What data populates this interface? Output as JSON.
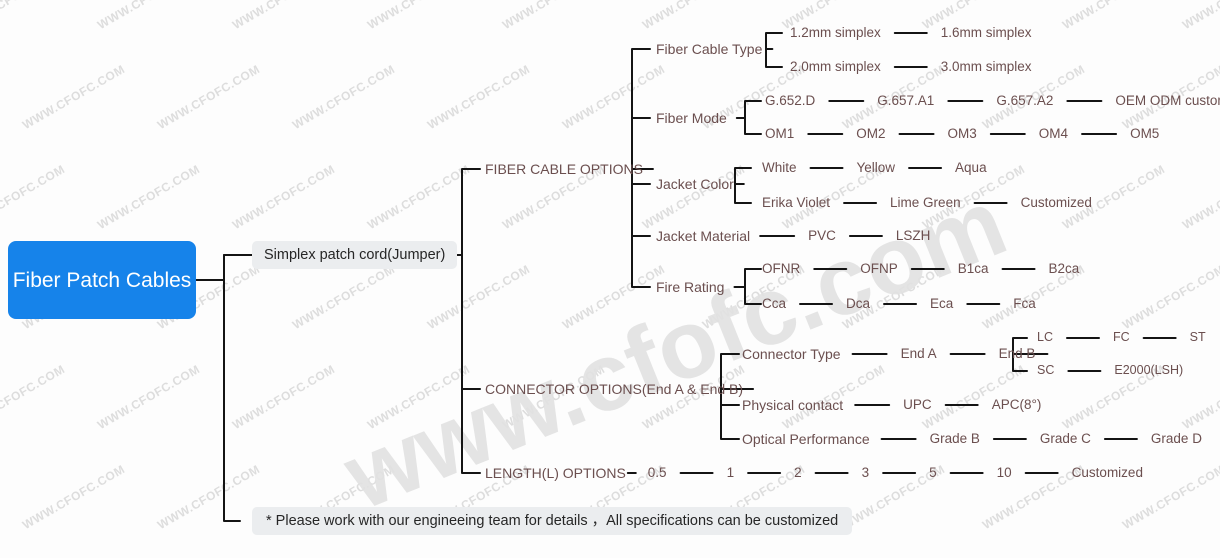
{
  "theme": {
    "root_fill": "#1683ea",
    "root_text": "#ffffff",
    "box_fill": "#ebedef",
    "box_text": "#262626",
    "leaf_text": "#6b4f4f",
    "line_color": "#141414",
    "watermark_color": "#d8d8d8",
    "background": "#fdfdfd"
  },
  "watermark": {
    "text": "WWW.CFOFC.COM",
    "big_text": "www.cfofc.com"
  },
  "root": {
    "label": "Fiber Patch Cables"
  },
  "branch": {
    "label": "Simplex patch cord(Jumper)"
  },
  "note": {
    "label": "* Please work with our engineeing team for details ，All specifications can be customized"
  },
  "sections": [
    {
      "label": "FIBER CABLE OPTIONS"
    },
    {
      "label": "CONNECTOR OPTIONS(End A & End B)"
    },
    {
      "label": "LENGTH(L) OPTIONS"
    }
  ],
  "fiber_cable_options": {
    "attributes": [
      {
        "label": "Fiber Cable Type",
        "rows": [
          [
            "1.2mm simplex",
            "1.6mm simplex"
          ],
          [
            "2.0mm simplex",
            "3.0mm simplex"
          ]
        ]
      },
      {
        "label": "Fiber Mode",
        "rows": [
          [
            "G.652.D",
            "G.657.A1",
            "G.657.A2",
            "OEM ODM customized services"
          ],
          [
            "OM1",
            "OM2",
            "OM3",
            "OM4",
            "OM5"
          ]
        ]
      },
      {
        "label": "Jacket Color",
        "rows": [
          [
            "White",
            "Yellow",
            "Aqua"
          ],
          [
            "Erika Violet",
            "Lime Green",
            "Customized"
          ]
        ]
      },
      {
        "label": "Jacket Material",
        "rows": [
          [
            "PVC",
            "LSZH"
          ]
        ]
      },
      {
        "label": "Fire Rating",
        "rows": [
          [
            "OFNR",
            "OFNP",
            "B1ca",
            "B2ca"
          ],
          [
            "Cca",
            "Dca",
            "Eca",
            "Fca"
          ]
        ]
      }
    ]
  },
  "connector_options": {
    "attributes": [
      {
        "label": "Connector Type",
        "chain": [
          "End A",
          "End B"
        ],
        "sub_rows": [
          [
            "LC",
            "FC",
            "ST"
          ],
          [
            "SC",
            "E2000(LSH)"
          ]
        ]
      },
      {
        "label": "Physical contact",
        "chain": [
          "UPC",
          "APC(8°)"
        ]
      },
      {
        "label": "Optical Performance",
        "chain": [
          "Grade B",
          "Grade C",
          "Grade D"
        ]
      }
    ]
  },
  "length_options": {
    "values": [
      "0.5",
      "1",
      "2",
      "3",
      "5",
      "10",
      "Customized"
    ]
  }
}
